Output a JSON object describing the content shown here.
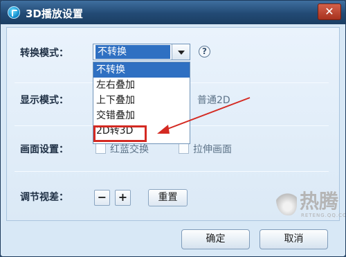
{
  "window": {
    "title": "3D播放设置",
    "close_symbol": "✕"
  },
  "conversion": {
    "label": "转换模式：",
    "selected": "不转换",
    "help_symbol": "?",
    "options": [
      "不转换",
      "左右叠加",
      "上下叠加",
      "交错叠加",
      "2D转3D"
    ]
  },
  "display": {
    "label": "显示模式：",
    "option_text": "普通2D"
  },
  "picture": {
    "label": "画面设置：",
    "option1": "红蓝交换",
    "option2": "拉伸画面"
  },
  "parallax": {
    "label": "调节视差：",
    "minus": "−",
    "plus": "+",
    "reset": "重置"
  },
  "footer": {
    "ok": "确定",
    "cancel": "取消"
  },
  "watermark": {
    "brand": "热腾",
    "url": "RETENG.QQ.COM"
  },
  "colors": {
    "accent": "#2f70c2",
    "highlight": "#d42a22"
  }
}
